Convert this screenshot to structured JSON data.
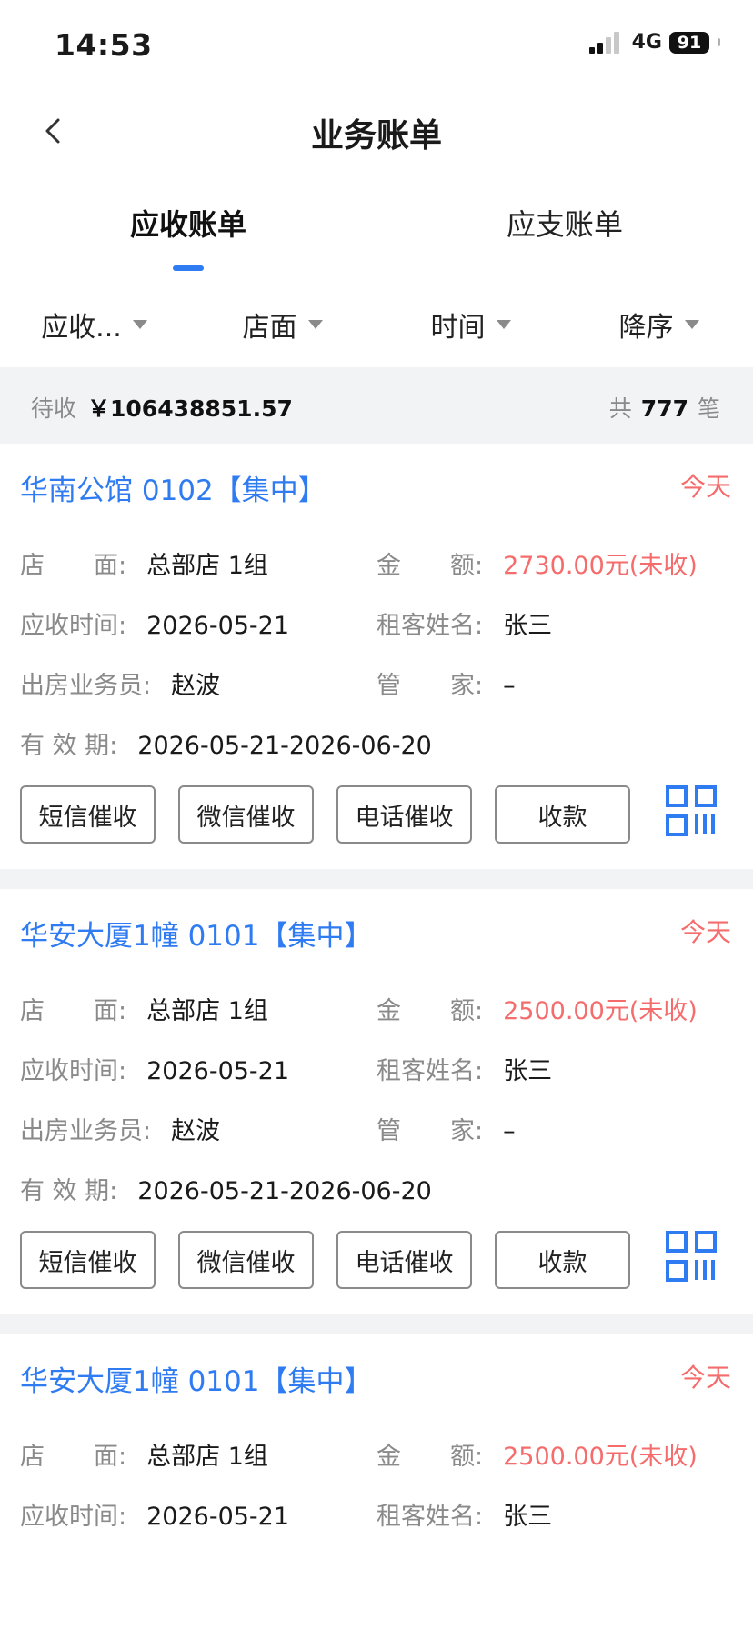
{
  "status_bar": {
    "time": "14:53",
    "network": "4G",
    "battery": "91"
  },
  "nav": {
    "title": "业务账单"
  },
  "tabs": [
    {
      "label": "应收账单",
      "active": true
    },
    {
      "label": "应支账单",
      "active": false
    }
  ],
  "filters": [
    {
      "label": "应收..."
    },
    {
      "label": "店面"
    },
    {
      "label": "时间"
    },
    {
      "label": "降序"
    }
  ],
  "summary": {
    "pending_label": "待收",
    "pending_amount": "￥106438851.57",
    "total_prefix": "共",
    "total_count": "777",
    "total_suffix": "笔"
  },
  "field_labels": {
    "store": "店　　面:",
    "amount": "金　　额:",
    "due_time": "应收时间:",
    "tenant": "租客姓名:",
    "agent": "出房业务员:",
    "manager": "管　　家:",
    "validity": "有 效 期:"
  },
  "actions": {
    "sms": "短信催收",
    "wechat": "微信催收",
    "phone": "电话催收",
    "collect": "收款"
  },
  "bills": [
    {
      "title": "华南公馆 0102【集中】",
      "tag": "今天",
      "store": "总部店 1组",
      "amount": "2730.00元(未收)",
      "due_time": "2026-05-21",
      "tenant": "张三",
      "agent": "赵波",
      "manager": "–",
      "validity": "2026-05-21-2026-06-20"
    },
    {
      "title": "华安大厦1幢 0101【集中】",
      "tag": "今天",
      "store": "总部店 1组",
      "amount": "2500.00元(未收)",
      "due_time": "2026-05-21",
      "tenant": "张三",
      "agent": "赵波",
      "manager": "–",
      "validity": "2026-05-21-2026-06-20"
    },
    {
      "title": "华安大厦1幢 0101【集中】",
      "tag": "今天",
      "store": "总部店 1组",
      "amount": "2500.00元(未收)",
      "due_time": "2026-05-21",
      "tenant": "张三"
    }
  ],
  "colors": {
    "accent_blue": "#2f7bf2",
    "status_red": "#f56c6c",
    "label_gray": "#8a8a8a",
    "section_bg": "#f2f3f5"
  }
}
